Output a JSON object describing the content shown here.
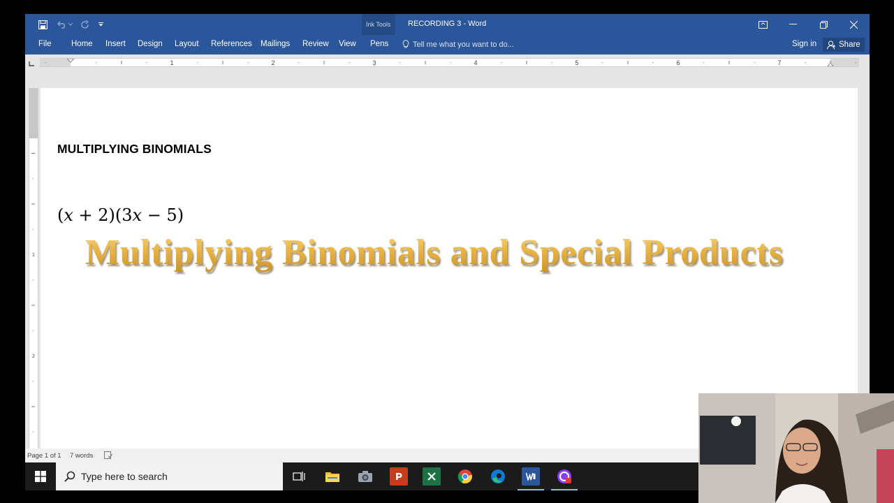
{
  "window": {
    "title": "RECORDING 3 - Word",
    "contextual_group": "Ink Tools"
  },
  "ribbon": {
    "tabs": [
      {
        "label": "File"
      },
      {
        "label": "Home"
      },
      {
        "label": "Insert"
      },
      {
        "label": "Design"
      },
      {
        "label": "Layout"
      },
      {
        "label": "References"
      },
      {
        "label": "Mailings"
      },
      {
        "label": "Review"
      },
      {
        "label": "View"
      },
      {
        "label": "Pens"
      }
    ],
    "tell_me": "Tell me what you want to do...",
    "sign_in": "Sign in",
    "share": "Share"
  },
  "ruler": {
    "numbers": [
      "1",
      "2",
      "3",
      "4",
      "5",
      "6",
      "7"
    ],
    "vertical_numbers": [
      "1",
      "2"
    ]
  },
  "document": {
    "heading": "MULTIPLYING BINOMIALS",
    "equation": "(𝑥 + 2)(3𝑥 − 5)",
    "wordart": "Multiplying Binomials and Special Products"
  },
  "status": {
    "page": "Page 1 of 1",
    "words": "7 words"
  },
  "taskbar": {
    "search_placeholder": "Type here to search",
    "apps": [
      "task-view",
      "file-explorer",
      "camera",
      "powerpoint",
      "excel",
      "chrome",
      "edge",
      "word",
      "screen-recorder"
    ]
  },
  "colors": {
    "ribbon": "#2b579a",
    "wordart_gold": "#e9b443",
    "taskbar": "#1b1b1b"
  }
}
